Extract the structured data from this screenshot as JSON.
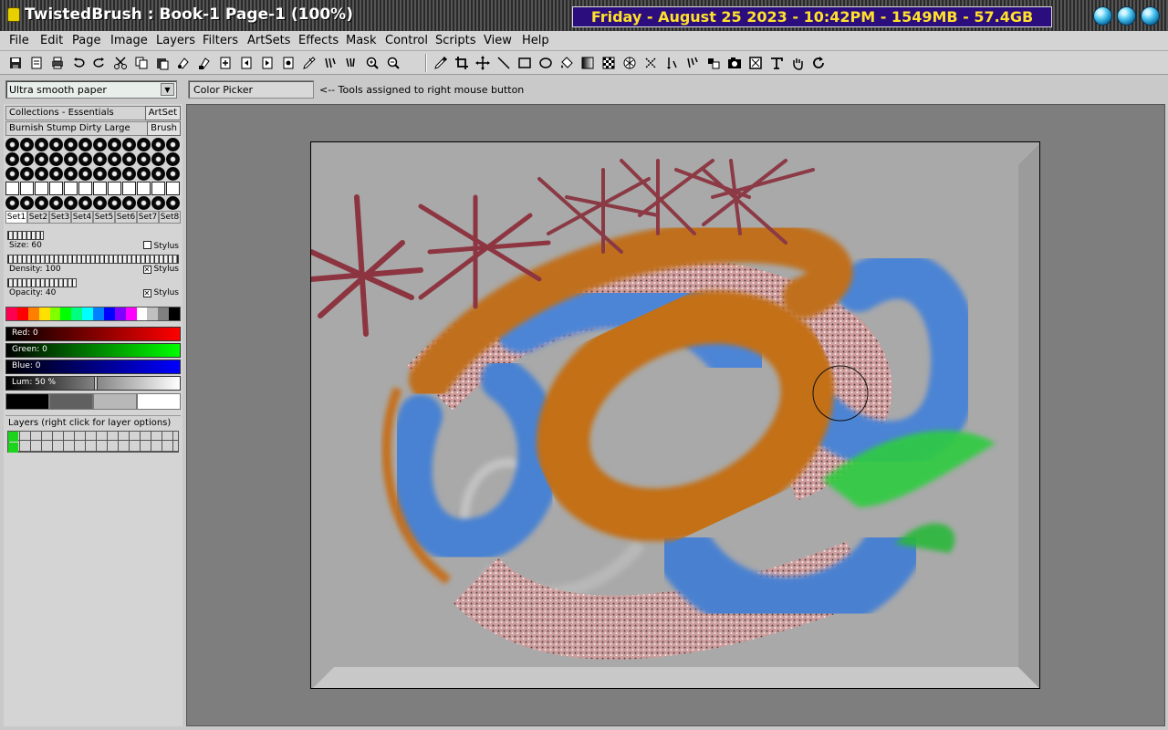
{
  "titlebar": {
    "title": "TwistedBrush : Book-1 Page-1 (100%)",
    "clock": "Friday - August 25 2023 - 10:42PM - 1549MB - 57.4GB"
  },
  "menu": [
    "File",
    "Edit",
    "Page",
    "Image",
    "Layers",
    "Filters",
    "ArtSets",
    "Effects",
    "Mask",
    "Control",
    "Scripts",
    "View",
    "Help"
  ],
  "toolbar": {
    "left_icons": [
      "save-icon",
      "page-icon",
      "print-icon",
      "undo-icon",
      "redo-icon",
      "cut-icon",
      "copy-icon",
      "paste-icon",
      "clone-icon",
      "copy-image-icon",
      "page-new-icon",
      "page-prev-icon",
      "page-next-icon",
      "page-list-icon",
      "brush-edit-icon",
      "script-icon",
      "zoom-in-icon",
      "zoom-out-icon"
    ],
    "right_icons": [
      "color-picker-icon",
      "crop-icon",
      "move-icon",
      "line-icon",
      "rectangle-icon",
      "ellipse-icon",
      "fill-icon",
      "gradient-icon",
      "pattern-icon",
      "texture-icon",
      "selection-icon",
      "mask-paint-icon",
      "brush-select-icon",
      "stamp-icon",
      "image-icon",
      "frame-icon",
      "text-icon",
      "hand-icon",
      "rotate-icon"
    ]
  },
  "paper": {
    "selected": "Ultra smooth paper"
  },
  "right_tool": {
    "name": "Color Picker",
    "hint": "<-- Tools assigned to right mouse button"
  },
  "panel": {
    "collection": "Collections - Essentials",
    "artset_btn": "ArtSet",
    "brush": "Burnish Stump Dirty Large",
    "brush_btn": "Brush",
    "set_tabs": [
      "Set1",
      "Set2",
      "Set3",
      "Set4",
      "Set5",
      "Set6",
      "Set7",
      "Set8"
    ],
    "size_label": "Size: 60",
    "density_label": "Density: 100",
    "opacity_label": "Opacity: 40",
    "stylus": "Stylus",
    "red_label": "Red: 0",
    "green_label": "Green: 0",
    "blue_label": "Blue: 0",
    "lum_label": "Lum: 50 %",
    "layers_label": "Layers (right click for layer options)"
  },
  "palette_colors": [
    "#ff0050",
    "#ff0000",
    "#ff8000",
    "#ffe000",
    "#80ff00",
    "#00ff00",
    "#00ff80",
    "#00ffff",
    "#0080ff",
    "#0000ff",
    "#8000ff",
    "#ff00ff",
    "#ffffff",
    "#c0c0c0",
    "#808080",
    "#000000"
  ],
  "gray_swatches": [
    "#000000",
    "#606060",
    "#b8b8b8",
    "#ffffff"
  ]
}
